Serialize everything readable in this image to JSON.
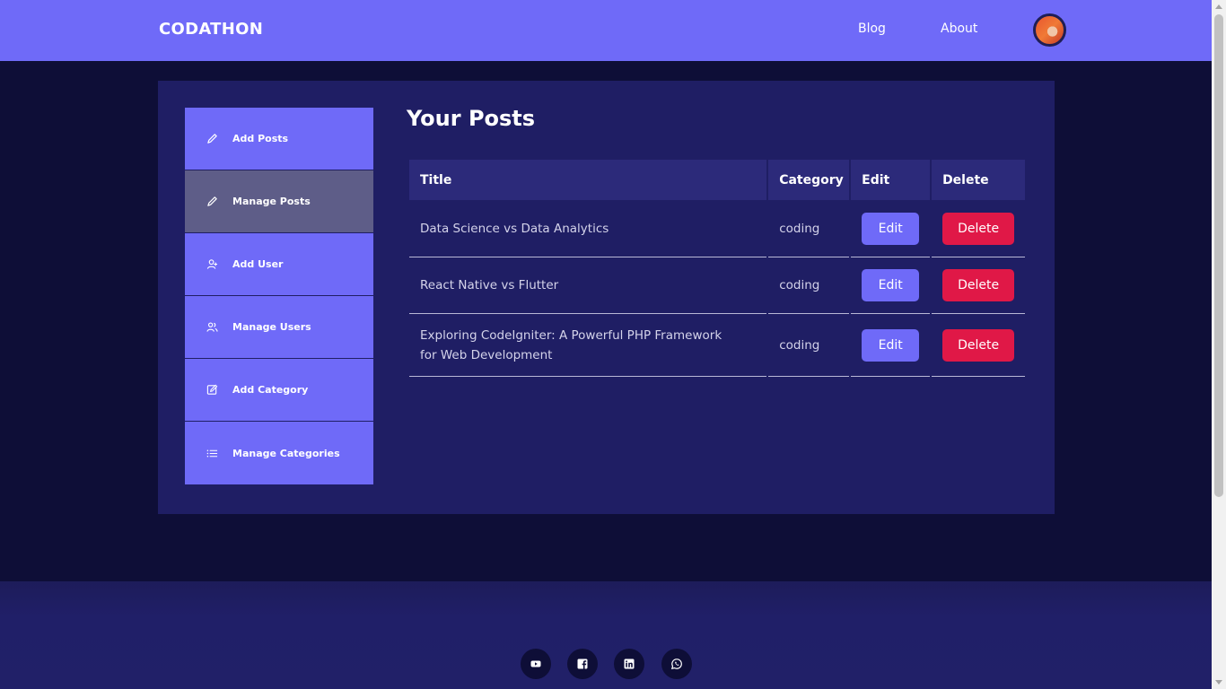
{
  "header": {
    "logo": "CODATHON",
    "nav": [
      "Blog",
      "About"
    ]
  },
  "sidebar": {
    "items": [
      {
        "label": "Add Posts",
        "icon": "pencil-icon"
      },
      {
        "label": "Manage Posts",
        "icon": "pencil-icon",
        "active": true
      },
      {
        "label": "Add User",
        "icon": "user-add-icon"
      },
      {
        "label": "Manage Users",
        "icon": "users-icon"
      },
      {
        "label": "Add Category",
        "icon": "edit-box-icon"
      },
      {
        "label": "Manage Categories",
        "icon": "list-icon"
      }
    ]
  },
  "main": {
    "title": "Your Posts",
    "columns": [
      "Title",
      "Category",
      "Edit",
      "Delete"
    ],
    "rows": [
      {
        "title": "Data Science vs Data Analytics",
        "category": "coding",
        "edit": "Edit",
        "delete": "Delete"
      },
      {
        "title": "React Native vs Flutter",
        "category": "coding",
        "edit": "Edit",
        "delete": "Delete"
      },
      {
        "title": "Exploring CodeIgniter: A Powerful PHP Framework for Web Development",
        "category": "coding",
        "edit": "Edit",
        "delete": "Delete"
      }
    ]
  },
  "footer": {
    "social": [
      "youtube-icon",
      "facebook-icon",
      "linkedin-icon",
      "whatsapp-icon"
    ]
  },
  "colors": {
    "accent": "#6f6af8",
    "background": "#0e0e37",
    "panel": "#1f1e64",
    "delete": "#e01847",
    "active": "#5e5d88"
  }
}
